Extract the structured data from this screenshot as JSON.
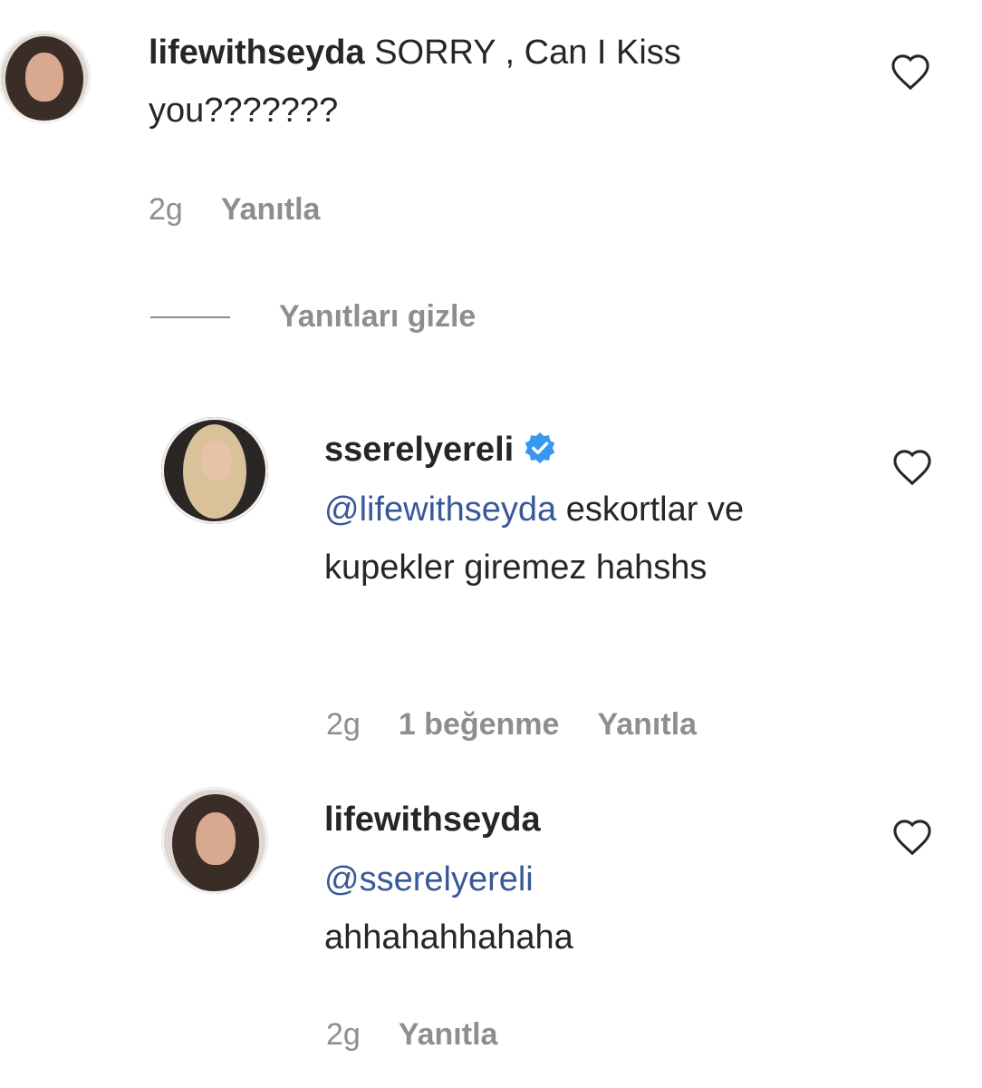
{
  "comments": [
    {
      "username": "lifewithseyda",
      "text": " SORRY , Can I Kiss you???????",
      "time": "2g",
      "reply_label": "Yanıtla",
      "avatar_icon": "avatar-woman-dark-hair"
    }
  ],
  "toggle": {
    "label": "Yanıtları gizle"
  },
  "replies": [
    {
      "username": "sserelyereli",
      "verified": true,
      "mention": "@lifewithseyda",
      "text": " eskortlar ve kupekler giremez hahshs",
      "time": "2g",
      "likes": "1 beğenme",
      "reply_label": "Yanıtla",
      "avatar_icon": "avatar-woman-blonde"
    },
    {
      "username": "lifewithseyda",
      "verified": false,
      "mention": "@sserelyereli",
      "text": "ahhahahhahaha",
      "time": "2g",
      "reply_label": "Yanıtla",
      "avatar_icon": "avatar-woman-dark-hair"
    }
  ],
  "icons": {
    "like": "heart-outline-icon",
    "verified": "verified-badge-icon"
  },
  "colors": {
    "text": "#262626",
    "secondary": "#8e8e8e",
    "mention": "#385898",
    "verified": "#3897f0"
  }
}
